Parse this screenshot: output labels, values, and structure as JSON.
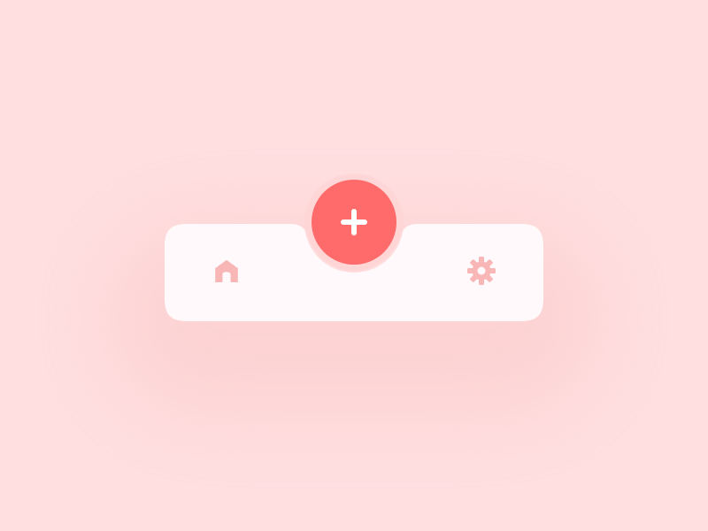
{
  "background_color": "#ffdfe0",
  "tabbar": {
    "bar_color": "#fff9fb",
    "items": [
      {
        "name": "home",
        "icon": "home-icon",
        "color": "#f8b6b7",
        "active": false
      },
      {
        "name": "settings",
        "icon": "gear-icon",
        "color": "#f8b6b7",
        "active": false
      }
    ],
    "fab": {
      "icon": "plus-icon",
      "color": "#ff6b6b",
      "ring_color": "#ffd4d5",
      "icon_color": "#ffffff"
    }
  }
}
